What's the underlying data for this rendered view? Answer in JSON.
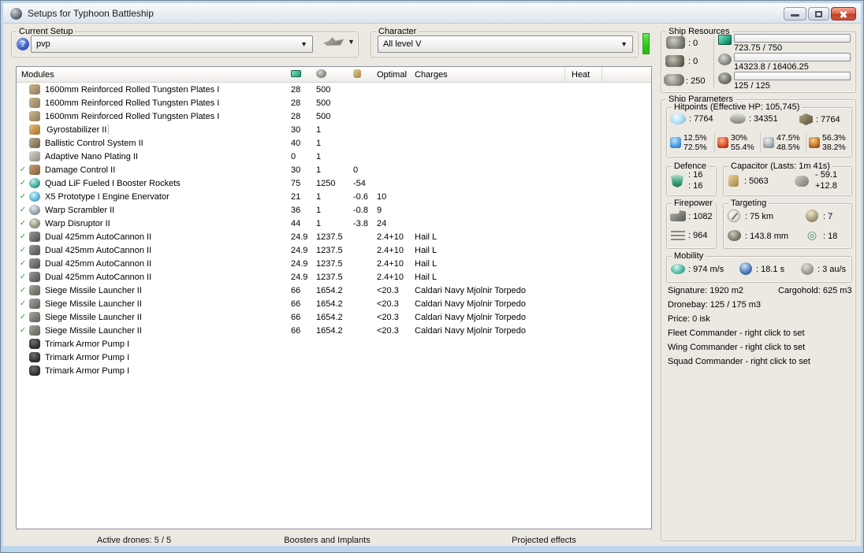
{
  "window": {
    "title": "Setups for Typhoon Battleship",
    "controls": {
      "minimize": "minimize",
      "maximize": "maximize",
      "close": "close"
    }
  },
  "toolbar": {
    "current_setup": {
      "label": "Current Setup",
      "value": "pvp",
      "help_glyph": "?"
    },
    "character": {
      "label": "Character",
      "value": "All level V"
    }
  },
  "modules_table": {
    "columns": {
      "modules": "Modules",
      "optimal": "Optimal",
      "charges": "Charges",
      "heat": "Heat"
    },
    "column_icons": [
      "cpu-icon",
      "powergrid-icon",
      "capacitor-icon"
    ],
    "check_icon": "✓",
    "rows": [
      {
        "checked": false,
        "icon": "armor-plate",
        "name": "1600mm Reinforced Rolled Tungsten Plates I",
        "cpu": "28",
        "pg": "500",
        "cap": "",
        "optimal": "",
        "charges": ""
      },
      {
        "checked": false,
        "icon": "armor-plate",
        "name": "1600mm Reinforced Rolled Tungsten Plates I",
        "cpu": "28",
        "pg": "500",
        "cap": "",
        "optimal": "",
        "charges": ""
      },
      {
        "checked": false,
        "icon": "armor-plate",
        "name": "1600mm Reinforced Rolled Tungsten Plates I",
        "cpu": "28",
        "pg": "500",
        "cap": "",
        "optimal": "",
        "charges": ""
      },
      {
        "checked": false,
        "icon": "gyrostabilizer",
        "name": "Gyrostabilizer II",
        "cpu": "30",
        "pg": "1",
        "cap": "",
        "optimal": "",
        "charges": "",
        "focused": true
      },
      {
        "checked": false,
        "icon": "ballistic-control",
        "name": "Ballistic Control System II",
        "cpu": "40",
        "pg": "1",
        "cap": "",
        "optimal": "",
        "charges": ""
      },
      {
        "checked": false,
        "icon": "nano-plating",
        "name": "Adaptive Nano Plating II",
        "cpu": "0",
        "pg": "1",
        "cap": "",
        "optimal": "",
        "charges": ""
      },
      {
        "checked": true,
        "icon": "damage-control",
        "name": "Damage Control II",
        "cpu": "30",
        "pg": "1",
        "cap": "0",
        "optimal": "",
        "charges": ""
      },
      {
        "checked": true,
        "icon": "booster-rockets",
        "name": "Quad LiF Fueled I Booster Rockets",
        "cpu": "75",
        "pg": "1250",
        "cap": "-54",
        "optimal": "",
        "charges": ""
      },
      {
        "checked": true,
        "icon": "engine-enervator",
        "name": "X5 Prototype I Engine Enervator",
        "cpu": "21",
        "pg": "1",
        "cap": "-0.6",
        "optimal": "10",
        "charges": ""
      },
      {
        "checked": true,
        "icon": "warp-scrambler",
        "name": "Warp Scrambler II",
        "cpu": "36",
        "pg": "1",
        "cap": "-0.8",
        "optimal": "9",
        "charges": ""
      },
      {
        "checked": true,
        "icon": "warp-disruptor",
        "name": "Warp Disruptor II",
        "cpu": "44",
        "pg": "1",
        "cap": "-3.8",
        "optimal": "24",
        "charges": ""
      },
      {
        "checked": true,
        "icon": "autocannon",
        "name": "Dual 425mm AutoCannon II",
        "cpu": "24.9",
        "pg": "1237.5",
        "cap": "",
        "optimal": "2.4+10",
        "charges": "Hail L"
      },
      {
        "checked": true,
        "icon": "autocannon",
        "name": "Dual 425mm AutoCannon II",
        "cpu": "24.9",
        "pg": "1237.5",
        "cap": "",
        "optimal": "2.4+10",
        "charges": "Hail L"
      },
      {
        "checked": true,
        "icon": "autocannon",
        "name": "Dual 425mm AutoCannon II",
        "cpu": "24.9",
        "pg": "1237.5",
        "cap": "",
        "optimal": "2.4+10",
        "charges": "Hail L"
      },
      {
        "checked": true,
        "icon": "autocannon",
        "name": "Dual 425mm AutoCannon II",
        "cpu": "24.9",
        "pg": "1237.5",
        "cap": "",
        "optimal": "2.4+10",
        "charges": "Hail L"
      },
      {
        "checked": true,
        "icon": "missile-launcher",
        "name": "Siege Missile Launcher II",
        "cpu": "66",
        "pg": "1654.2",
        "cap": "",
        "optimal": "<20.3",
        "charges": "Caldari Navy Mjolnir Torpedo"
      },
      {
        "checked": true,
        "icon": "missile-launcher",
        "name": "Siege Missile Launcher II",
        "cpu": "66",
        "pg": "1654.2",
        "cap": "",
        "optimal": "<20.3",
        "charges": "Caldari Navy Mjolnir Torpedo"
      },
      {
        "checked": true,
        "icon": "missile-launcher",
        "name": "Siege Missile Launcher II",
        "cpu": "66",
        "pg": "1654.2",
        "cap": "",
        "optimal": "<20.3",
        "charges": "Caldari Navy Mjolnir Torpedo"
      },
      {
        "checked": true,
        "icon": "missile-launcher",
        "name": "Siege Missile Launcher II",
        "cpu": "66",
        "pg": "1654.2",
        "cap": "",
        "optimal": "<20.3",
        "charges": "Caldari Navy Mjolnir Torpedo"
      },
      {
        "checked": false,
        "icon": "rig",
        "name": "Trimark Armor Pump I",
        "cpu": "",
        "pg": "",
        "cap": "",
        "optimal": "",
        "charges": ""
      },
      {
        "checked": false,
        "icon": "rig",
        "name": "Trimark Armor Pump I",
        "cpu": "",
        "pg": "",
        "cap": "",
        "optimal": "",
        "charges": ""
      },
      {
        "checked": false,
        "icon": "rig",
        "name": "Trimark Armor Pump I",
        "cpu": "",
        "pg": "",
        "cap": "",
        "optimal": "",
        "charges": ""
      }
    ]
  },
  "bottom_sections": {
    "active_drones": "Active drones: 5 / 5",
    "boosters": "Boosters and Implants",
    "projected": "Projected effects"
  },
  "ship_resources": {
    "label": "Ship Resources",
    "turret_hardpoints": ": 0",
    "launcher_hardpoints": ": 0",
    "calibration": ": 250",
    "bars": [
      {
        "name": "cpu",
        "text": "723.75 / 750",
        "fraction": 0.965
      },
      {
        "name": "powergrid",
        "text": "14323.8 / 16406.25",
        "fraction": 0.873
      },
      {
        "name": "drone-bandwidth",
        "text": "125 / 125",
        "fraction": 1.0
      }
    ]
  },
  "ship_parameters": {
    "label": "Ship Parameters",
    "hitpoints": {
      "label": "Hitpoints (Effective HP: 105,745)",
      "shield": ": 7764",
      "armor": ": 34351",
      "hull": ": 7764",
      "resists": [
        {
          "icon": "em",
          "top": "12.5%",
          "bottom": "72.5%"
        },
        {
          "icon": "thermal",
          "top": "30%",
          "bottom": "55.4%"
        },
        {
          "icon": "kinetic",
          "top": "47.5%",
          "bottom": "48.5%"
        },
        {
          "icon": "explosive",
          "top": "56.3%",
          "bottom": "38.2%"
        }
      ]
    },
    "defence": {
      "label": "Defence",
      "value1": ": 16",
      "value2": ": 16"
    },
    "capacitor": {
      "label": "Capacitor (Lasts: 1m 41s)",
      "amount": ": 5063",
      "drain": "- 59.1",
      "boost": "+12.8"
    },
    "firepower": {
      "label": "Firepower",
      "dps": ": 1082",
      "volley": ": 964"
    },
    "targeting": {
      "label": "Targeting",
      "range": ": 75 km",
      "scan_resolution": ": 143.8 mm",
      "sensor_strength": ": 7",
      "max_targets": ": 18"
    },
    "mobility": {
      "label": "Mobility",
      "speed": ": 974 m/s",
      "align_time": ": 18.1 s",
      "warp_speed": ": 3 au/s"
    },
    "lock_glyph": "◎"
  },
  "info": {
    "signature": "Signature: 1920 m2",
    "cargohold": "Cargohold: 625 m3",
    "dronebay": "Dronebay: 125 / 175 m3",
    "price": "Price: 0 isk",
    "fleet_commander": "Fleet Commander - right click to set",
    "wing_commander": "Wing Commander - right click to set",
    "squad_commander": "Squad Commander - right click to set"
  }
}
